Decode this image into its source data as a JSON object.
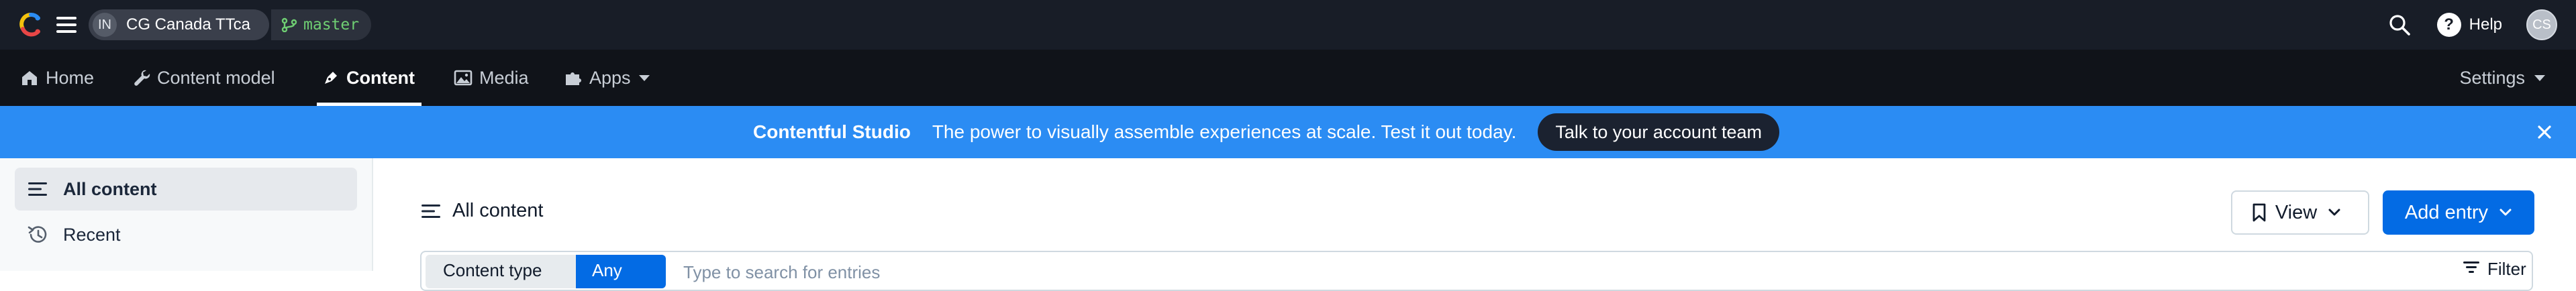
{
  "topbar": {
    "logo_icon": "contentful-logo-icon",
    "menu_icon": "hamburger-menu-icon",
    "space": {
      "initials": "IN",
      "name": "CG Canada TTca"
    },
    "environment": {
      "icon": "branch-icon",
      "name": "master",
      "color": "#6fcf73"
    },
    "search_icon": "search-icon",
    "help_label": "Help",
    "help_icon": "help-circle-icon",
    "avatar_initials": "CS"
  },
  "nav": {
    "items": [
      {
        "label": "Home",
        "icon": "home-icon"
      },
      {
        "label": "Content model",
        "icon": "wrench-icon"
      },
      {
        "label": "Content",
        "icon": "pen-nib-icon",
        "active": true
      },
      {
        "label": "Media",
        "icon": "image-icon"
      },
      {
        "label": "Apps",
        "icon": "puzzle-icon"
      }
    ],
    "settings_label": "Settings"
  },
  "banner": {
    "title": "Contentful Studio",
    "text": "The power to visually assemble experiences at scale. Test it out today.",
    "button_label": "Talk to your account team",
    "close_icon": "close-icon",
    "color": "#2b8cf3"
  },
  "sidebar": {
    "items": [
      {
        "label": "All content",
        "icon": "list-icon",
        "active": true
      },
      {
        "label": "Recent",
        "icon": "history-icon"
      }
    ]
  },
  "main": {
    "title": "All content",
    "title_icon": "list-icon",
    "view_button": "View",
    "add_entry_button": "Add entry",
    "accent": "#036be4",
    "search": {
      "content_type_label": "Content type",
      "any_label": "Any",
      "placeholder": "Type to search for entries",
      "filter_label": "Filter"
    }
  }
}
